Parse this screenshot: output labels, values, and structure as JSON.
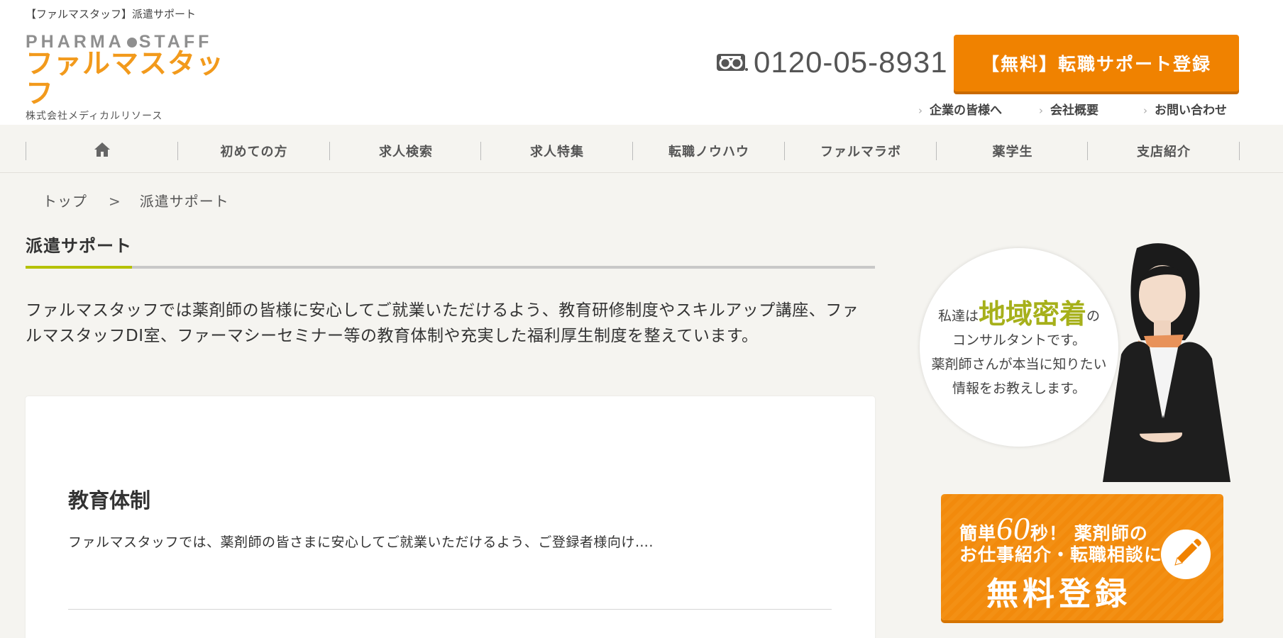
{
  "header": {
    "tagline": "【ファルマスタッフ】派遣サポート",
    "logo": {
      "en": "PHARMA STAFF",
      "jp": "ファルマスタッフ",
      "company": "株式会社メディカルリソース"
    },
    "phone": {
      "icon": "free-dial-icon",
      "number": "0120-05-8931"
    },
    "cta_label": "【無料】転職サポート登録",
    "sub_links": [
      "企業の皆様へ",
      "会社概要",
      "お問い合わせ"
    ]
  },
  "nav": {
    "home_icon": "home-icon",
    "items": [
      "初めての方",
      "求人検索",
      "求人特集",
      "転職ノウハウ",
      "ファルマラボ",
      "薬学生",
      "支店紹介"
    ]
  },
  "breadcrumb": {
    "items": [
      "トップ",
      "派遣サポート"
    ],
    "separator": ">"
  },
  "main": {
    "title": "派遣サポート",
    "intro_line1": "ファルマスタッフでは薬剤師の皆様に安心してご就業いただけるよう、教育研修制度やスキルアップ講座、ファ",
    "intro_line2": "ルマスタッフDI室、ファーマシーセミナー等の教育体制や充実した福利厚生制度を整えています。",
    "card": {
      "title": "教育体制",
      "text": "ファルマスタッフでは、薬剤師の皆さまに安心してご就業いただけるよう、ご登録者様向け…."
    }
  },
  "sidebar": {
    "bubble": {
      "pre": "私達は",
      "highlight": "地域密着",
      "post": "の",
      "line2": "コンサルタントです。",
      "line3": "薬剤師さんが本当に知りたい",
      "line4": "情報をお教えします。"
    },
    "register": {
      "line1_pre": "簡単",
      "line1_num": "60",
      "line1_post": "秒！ 薬剤師の",
      "line2": "お仕事紹介・転職相談に",
      "line3": "無料登録",
      "icon": "pencil-icon"
    }
  },
  "colors": {
    "accent_orange": "#f08200",
    "logo_orange": "#f29a1c",
    "accent_green": "#b5c100"
  }
}
